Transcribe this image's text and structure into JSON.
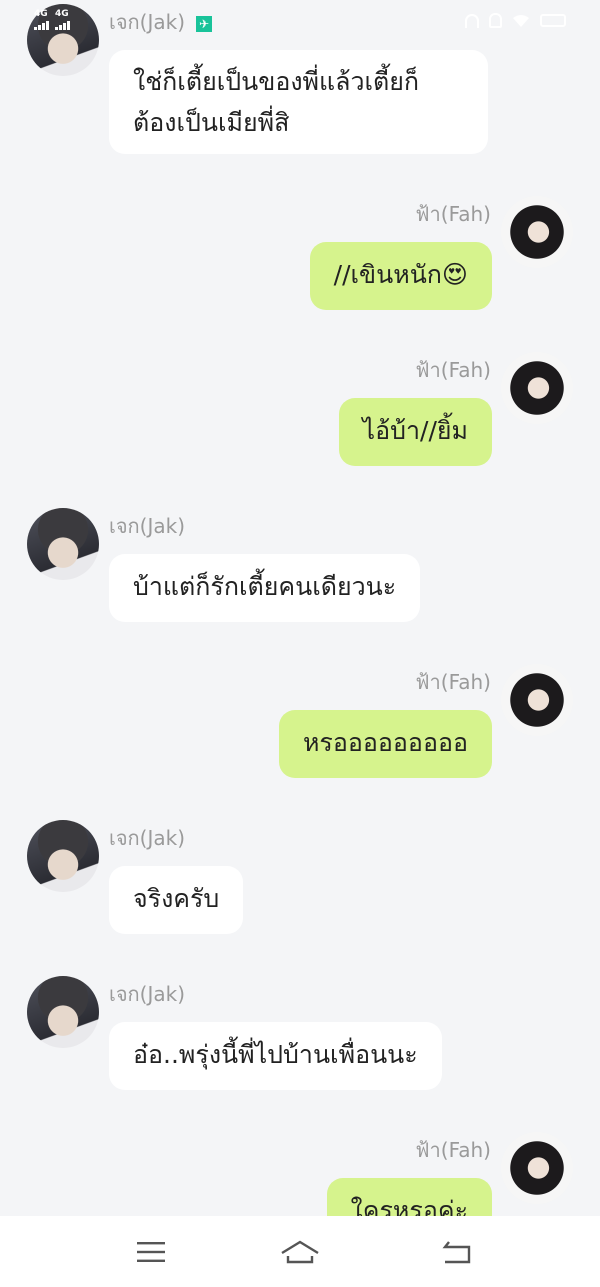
{
  "status_bar": {
    "network1": "4G",
    "network2": "4G",
    "icons": [
      "signal-icon",
      "signal-icon",
      "running-app-icon",
      "headphones-icon",
      "mute-bell-icon",
      "wifi-icon",
      "battery-icon"
    ]
  },
  "messages": [
    {
      "sender": "เจก(Jak)",
      "side": "left",
      "text_lines": [
        "ใช่ก็เตี้ยเป็นของพี่แล้วเตี้ยก็",
        "ต้องเป็นเมียพี่สิ"
      ]
    },
    {
      "sender": "ฟ้า(Fah)",
      "side": "right",
      "text": "//เขินหนัก😍"
    },
    {
      "sender": "ฟ้า(Fah)",
      "side": "right",
      "text": "ไอ้บ้า//ยิ้ม"
    },
    {
      "sender": "เจก(Jak)",
      "side": "left",
      "text": "บ้าแต่ก็รักเตี้ยคนเดียวนะ"
    },
    {
      "sender": "ฟ้า(Fah)",
      "side": "right",
      "text": "หรอออออออออ"
    },
    {
      "sender": "เจก(Jak)",
      "side": "left",
      "text": "จริงครับ"
    },
    {
      "sender": "เจก(Jak)",
      "side": "left",
      "text": "อ๋อ..พรุ่งนี้พี่ไปบ้านเพื่อนนะ"
    },
    {
      "sender": "ฟ้า(Fah)",
      "side": "right",
      "text": "ใครหรอค่ะ"
    }
  ],
  "navbar": {
    "buttons": [
      "menu-icon",
      "home-icon",
      "back-icon"
    ]
  },
  "colors": {
    "background": "#f4f5f7",
    "bubble_left": "#ffffff",
    "bubble_right": "#d6f38d",
    "name_text": "#9a9a9a"
  }
}
